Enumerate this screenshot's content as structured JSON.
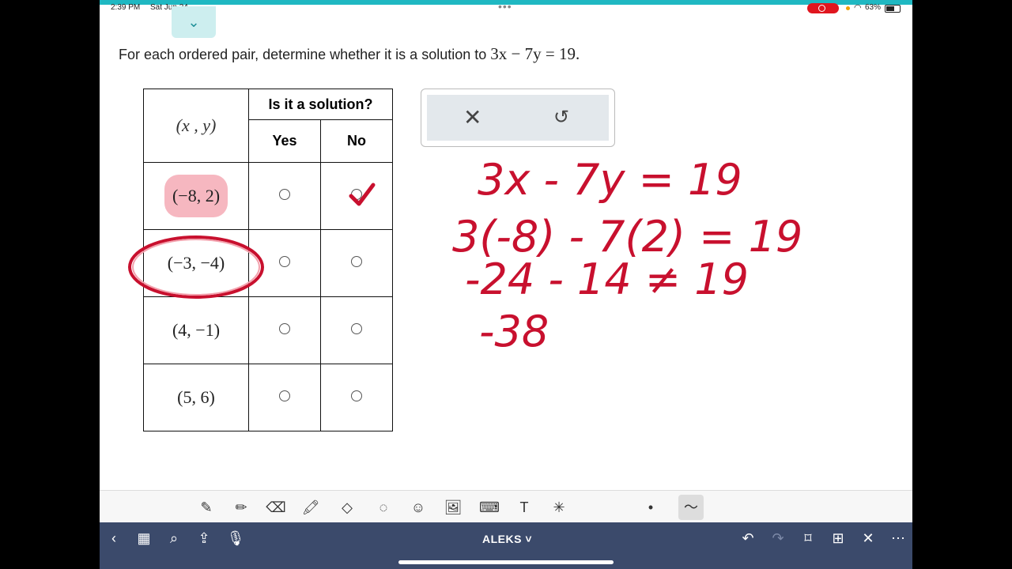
{
  "status_bar": {
    "time": "2:39 PM",
    "date": "Sat Jun 24",
    "battery": "63%"
  },
  "question": {
    "prefix": "For each ordered pair, determine whether it is a solution to",
    "equation": "3x − 7y = 19."
  },
  "table": {
    "header_pair": "(x , y)",
    "header_group": "Is it a solution?",
    "col_yes": "Yes",
    "col_no": "No",
    "rows": [
      {
        "pair": "(−8, 2)"
      },
      {
        "pair": "(−3, −4)"
      },
      {
        "pair": "(4, −1)"
      },
      {
        "pair": "(5, 6)"
      }
    ]
  },
  "answer_box": {
    "clear_icon": "✕",
    "undo_icon": "↺"
  },
  "handwriting": {
    "line1": "3x - 7y = 19",
    "line2": "3(-8) - 7(2) = 19",
    "line3": "-24 - 14 ≠ 19",
    "line4": "-38",
    "ink_color": "#c8102e"
  },
  "toolbar_icons": [
    "✎",
    "✏",
    "⌫",
    "🖍",
    "◇",
    "◌",
    "☺",
    "🖼",
    "⌨",
    "T",
    "✳",
    "•",
    "〜"
  ],
  "nav": {
    "title": "ALEKS ˅",
    "accent": "#3b4a6b"
  }
}
